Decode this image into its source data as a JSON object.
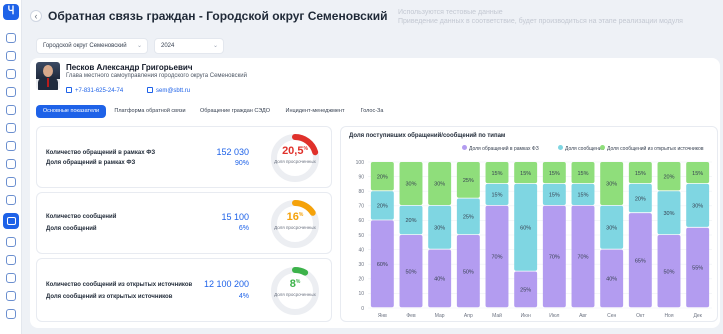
{
  "page": {
    "title": "Обратная связь граждан - Городской округ Семеновский",
    "test_note": [
      "Используются тестовые данные",
      "Приведение данных в соответствие, будет производиться на этапе реализации модуля"
    ]
  },
  "filters": {
    "region": "Городской округ Семеновский",
    "year": "2024"
  },
  "person": {
    "name": "Песков Александр Григорьевич",
    "role": "Глава местного самоуправления городского округа Семеновский",
    "phone": "+7-831-625-24-74",
    "email": "sem@sbtt.ru"
  },
  "tabs": [
    {
      "label": "Основные показатели",
      "active": true
    },
    {
      "label": "Платформа обратной связи",
      "active": false
    },
    {
      "label": "Обращение граждан СЭДО",
      "active": false
    },
    {
      "label": "Инцидент-менеджмент",
      "active": false
    },
    {
      "label": "Голос-За",
      "active": false
    }
  ],
  "kpis": [
    {
      "count_label": "Количество обращений в рамках ФЗ",
      "count_value": "152 030",
      "share_label": "Доля обращений в рамках ФЗ",
      "share_value": "90%",
      "ring_value": "20,5",
      "ring_unit": "%",
      "ring_label": "Доля просроченных",
      "ring_fraction": 0.205,
      "ring_color": "#e0312b",
      "value_color": "#e0312b"
    },
    {
      "count_label": "Количество сообщений",
      "count_value": "15 100",
      "share_label": "Доля сообщений",
      "share_value": "6%",
      "ring_value": "16",
      "ring_unit": "%",
      "ring_label": "Доля просроченных",
      "ring_fraction": 0.16,
      "ring_color": "#f5a20a",
      "value_color": "#f5a20a"
    },
    {
      "count_label": "Количество сообщений из открытых источников",
      "count_value": "12 100 200",
      "share_label": "Доля сообщений из открытых источников",
      "share_value": "4%",
      "ring_value": "8",
      "ring_unit": "%",
      "ring_label": "Доля просроченных",
      "ring_fraction": 0.08,
      "ring_color": "#3cb24a",
      "value_color": "#3cb24a"
    }
  ],
  "chart_data": {
    "type": "bar",
    "stacked": true,
    "title": "Доля поступивших обращений/сообщений по типам",
    "categories": [
      "Янв",
      "Фев",
      "Мар",
      "Апр",
      "Май",
      "Июн",
      "Июл",
      "Авг",
      "Сен",
      "Окт",
      "Ноя",
      "Дек"
    ],
    "series": [
      {
        "name": "Доля обращений в рамках ФЗ",
        "color": "#b39cf0",
        "values": [
          60,
          50,
          40,
          50,
          70,
          25,
          70,
          70,
          40,
          65,
          50,
          55
        ]
      },
      {
        "name": "Доля сообщений",
        "color": "#7fd6e2",
        "values": [
          20,
          20,
          30,
          25,
          15,
          60,
          15,
          15,
          30,
          20,
          30,
          30
        ]
      },
      {
        "name": "Доля сообщений из открытых источников",
        "color": "#8fde7b",
        "values": [
          20,
          30,
          30,
          25,
          15,
          15,
          15,
          15,
          30,
          15,
          20,
          15
        ]
      }
    ],
    "ylim": [
      0,
      100
    ],
    "yticks": [
      0,
      10,
      20,
      30,
      40,
      50,
      60,
      70,
      80,
      90,
      100
    ],
    "legend_position": "top-right",
    "grid": true
  }
}
